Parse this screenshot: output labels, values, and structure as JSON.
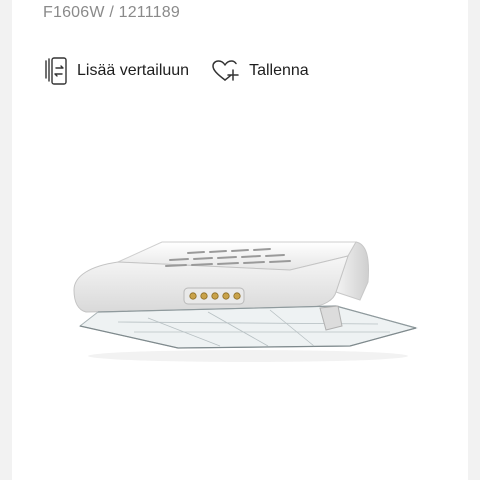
{
  "product": {
    "code_line": "F1606W / 1211189"
  },
  "actions": {
    "compare_label": "Lisää vertailuun",
    "save_label": "Tallenna"
  },
  "icons": {
    "compare": "compare-icon",
    "save": "heart-plus-icon"
  },
  "image": {
    "subject": "product-photo"
  },
  "colors": {
    "background": "#f2f2f2",
    "card": "#ffffff",
    "muted_text": "#8a8a8a",
    "text": "#1e1e1e",
    "icon_stroke": "#333333"
  }
}
